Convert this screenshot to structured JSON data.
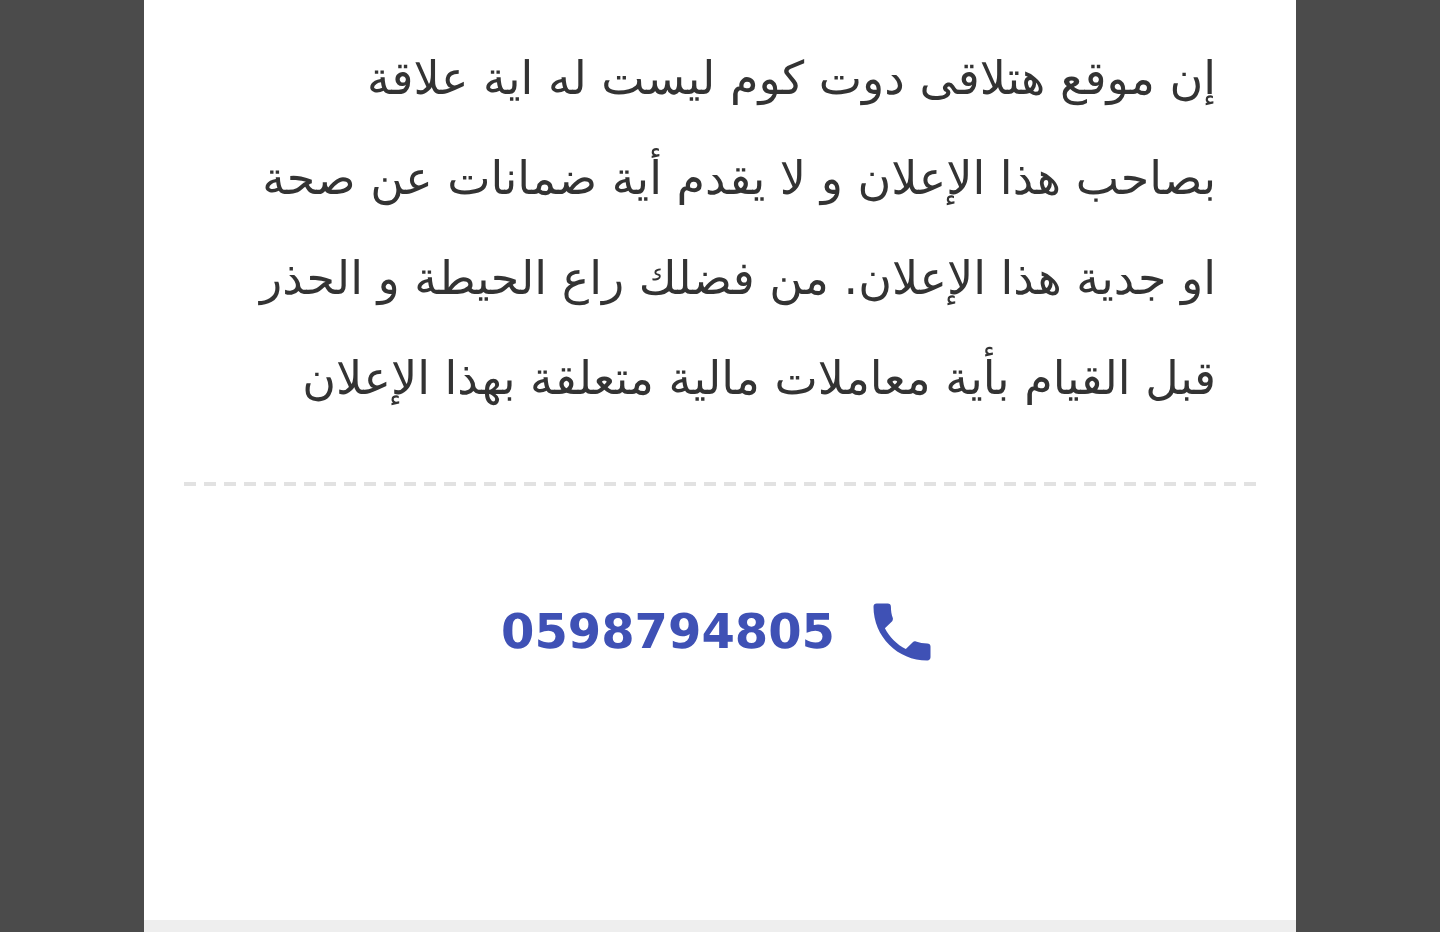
{
  "notice": {
    "text": "إن موقع هتلاقى دوت كوم ليست له اية علاقة بصاحب هذا الإعلان و لا يقدم أية ضمانات عن صحة او جدية هذا الإعلان. من فضلك راع الحيطة و الحذر قبل القيام بأية معاملات مالية متعلقة بهذا الإعلان"
  },
  "contact": {
    "phone": "0598794805"
  }
}
